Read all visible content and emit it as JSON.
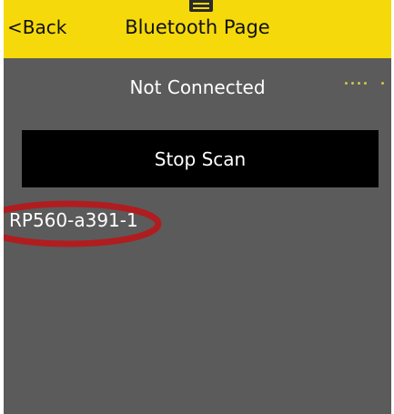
{
  "header": {
    "back_label": "<Back",
    "title": "Bluetooth Page"
  },
  "status": {
    "text": "Not Connected"
  },
  "scan_button": {
    "label": "Stop Scan"
  },
  "devices": [
    {
      "name": "RP560-a391-1"
    }
  ],
  "colors": {
    "header_bg": "#f5d90a",
    "page_bg": "#5b5b5b",
    "button_bg": "#000000",
    "highlight": "#b01d20"
  }
}
